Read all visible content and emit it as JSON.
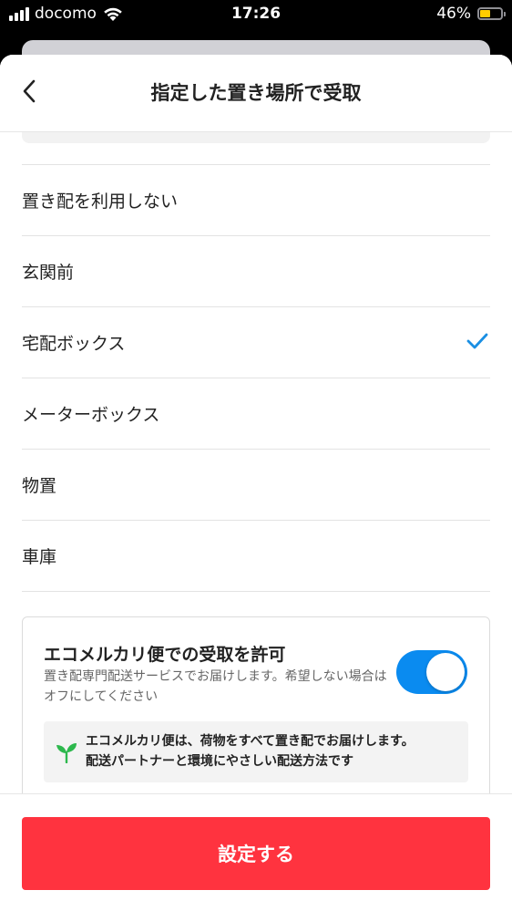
{
  "status_bar": {
    "carrier": "docomo",
    "time": "17:26",
    "battery_percent": "46%",
    "battery_level": 0.46,
    "signal_icon": "signal-bars-icon",
    "wifi_icon": "wifi-icon"
  },
  "header": {
    "title": "指定した置き場所で受取",
    "back_icon": "chevron-left-icon"
  },
  "options": [
    {
      "label": "置き配を利用しない",
      "selected": false
    },
    {
      "label": "玄関前",
      "selected": false
    },
    {
      "label": "宅配ボックス",
      "selected": true
    },
    {
      "label": "メーターボックス",
      "selected": false
    },
    {
      "label": "物置",
      "selected": false
    },
    {
      "label": "車庫",
      "selected": false
    }
  ],
  "eco": {
    "title": "エコメルカリ便での受取を許可",
    "description": "置き配専門配送サービスでお届けします。希望しない場合はオフにしてください",
    "toggle_on": true,
    "note_line1": "エコメルカリ便は、荷物をすべて置き配でお届けします。",
    "note_line2": "配送パートナーと環境にやさしい配送方法です",
    "note_icon": "leaf-sprout-icon"
  },
  "footer": {
    "submit_label": "設定する"
  },
  "colors": {
    "accent_red": "#ff333f",
    "toggle_blue": "#0a8bf0",
    "check_blue": "#1a8fe3",
    "leaf_green": "#2db84d",
    "battery_yellow": "#ffcc00"
  }
}
